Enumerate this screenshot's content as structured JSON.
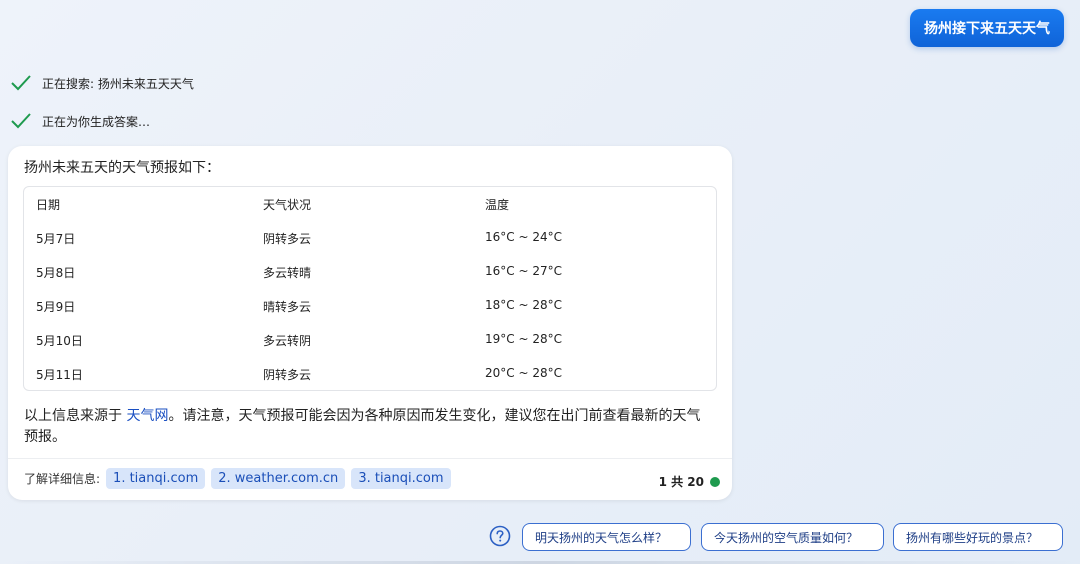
{
  "user_query": "扬州接下来五天天气",
  "progress": [
    {
      "text": "正在搜索: 扬州未来五天天气"
    },
    {
      "text": "正在为你生成答案…"
    }
  ],
  "answer": {
    "intro": "扬州未来五天的天气预报如下：",
    "table": {
      "headers": [
        "日期",
        "天气状况",
        "温度"
      ],
      "rows": [
        [
          "5月7日",
          "阴转多云",
          "16°C ~ 24°C"
        ],
        [
          "5月8日",
          "多云转晴",
          "16°C ~ 27°C"
        ],
        [
          "5月9日",
          "晴转多云",
          "18°C ~ 28°C"
        ],
        [
          "5月10日",
          "多云转阴",
          "19°C ~ 28°C"
        ],
        [
          "5月11日",
          "阴转多云",
          "20°C ~ 28°C"
        ]
      ]
    },
    "source_prefix": "以上信息来源于 ",
    "source_link": "天气网",
    "source_suffix": "。请注意，天气预报可能会因为各种原因而发生变化，建议您在出门前查看最新的天气预报。",
    "refs_label": "了解详细信息:",
    "refs": [
      "1. tianqi.com",
      "2. weather.com.cn",
      "3. tianqi.com"
    ],
    "counter": "1 共 20"
  },
  "suggestions": [
    "明天扬州的天气怎么样？",
    "今天扬州的空气质量如何？",
    "扬州有哪些好玩的景点？"
  ],
  "colors": {
    "accent": "#1a7bf0",
    "check": "#1e9a4e",
    "status_dot": "#1e9a4e",
    "link": "#1a4fc2"
  },
  "icons": {
    "progress": "check-icon",
    "suggestions": "help-circle-icon",
    "counter": "status-dot-icon"
  }
}
